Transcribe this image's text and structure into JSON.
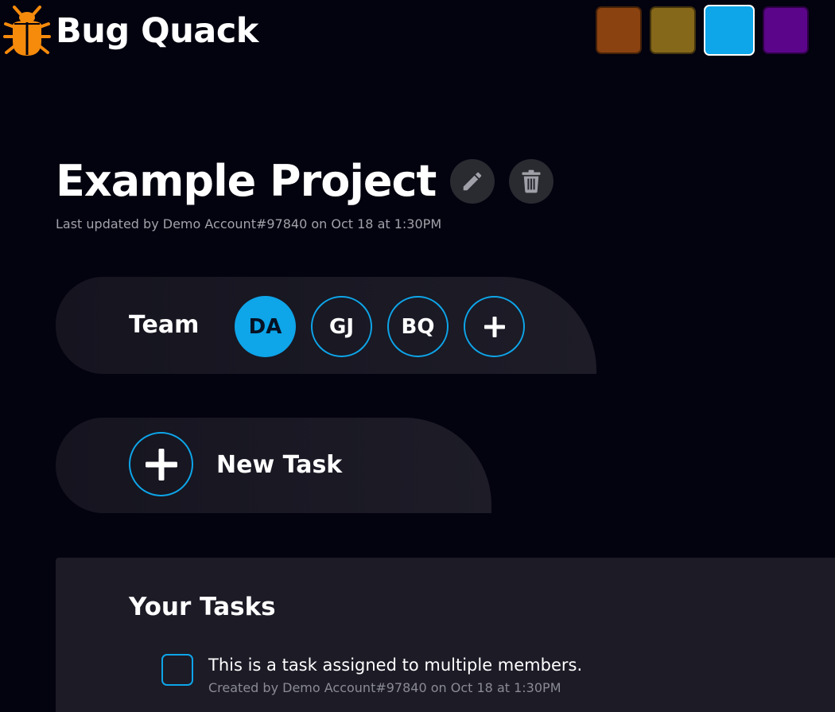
{
  "header": {
    "app_name": "Bug Quack",
    "logo_icon": "bug-icon",
    "theme_swatches": [
      {
        "name": "brown",
        "color": "#8a4210",
        "selected": false
      },
      {
        "name": "olive",
        "color": "#86681a",
        "selected": false
      },
      {
        "name": "blue",
        "color": "#0ea5e9",
        "selected": true
      },
      {
        "name": "purple",
        "color": "#5b058a",
        "selected": false
      }
    ]
  },
  "project": {
    "title": "Example Project",
    "last_updated": "Last updated by Demo Account#97840 on Oct 18 at 1:30PM",
    "edit_icon": "pencil-icon",
    "delete_icon": "trash-icon"
  },
  "team": {
    "label": "Team",
    "members": [
      {
        "initials": "DA",
        "active": true
      },
      {
        "initials": "GJ",
        "active": false
      },
      {
        "initials": "BQ",
        "active": false
      }
    ],
    "add_icon": "plus-icon"
  },
  "new_task": {
    "label": "New Task",
    "icon": "plus-icon"
  },
  "tasks": {
    "heading": "Your Tasks",
    "items": [
      {
        "title": "This is a task assigned to multiple members.",
        "meta": "Created by Demo Account#97840 on Oct 18 at 1:30PM",
        "checked": false
      }
    ]
  },
  "colors": {
    "accent": "#0ea5e9",
    "background": "#03020f",
    "panel": "#1c1b26",
    "logo": "#f58a0b"
  }
}
